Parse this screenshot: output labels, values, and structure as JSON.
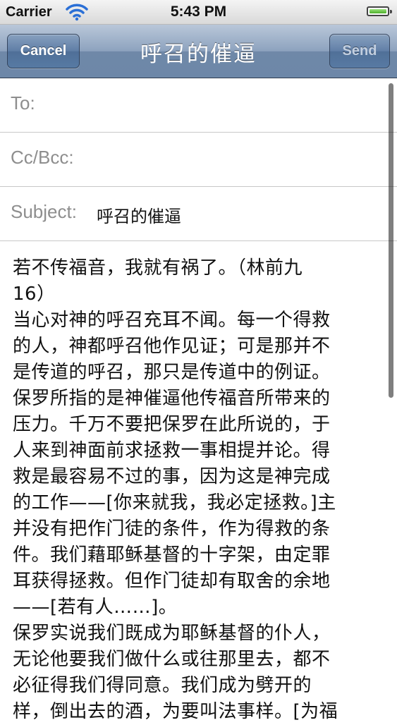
{
  "status_bar": {
    "carrier": "Carrier",
    "time": "5:43 PM",
    "icons": [
      "wifi-icon",
      "battery-icon"
    ]
  },
  "nav": {
    "title": "呼召的催逼",
    "cancel_label": "Cancel",
    "send_label": "Send"
  },
  "fields": {
    "to_label": "To:",
    "cc_label": "Cc/Bcc:",
    "subject_label": "Subject:",
    "subject_value": "呼召的催逼"
  },
  "body_lines": [
    "若不传福音，我就有祸了。（林前九",
    "16）",
    "当心对神的呼召充耳不闻。每一个得救",
    "的人，神都呼召他作见证；可是那并不",
    "是传道的呼召，那只是传道中的例证。",
    "保罗所指的是神催逼他传福音所带来的",
    "压力。千万不要把保罗在此所说的，于",
    "人来到神面前求拯救一事相提并论。得",
    "救是最容易不过的事，因为这是神完成",
    "的工作——[你来就我，我必定拯救。]主",
    "并没有把作门徒的条件，作为得救的条",
    "件。我们藉耶稣基督的十字架，由定罪",
    "耳获得拯救。但作门徒却有取舍的余地",
    "——[若有人……]。",
    "保罗实说我们既成为耶稣基督的仆人，",
    "无论他要我们做什么或往那里去，都不",
    "必征得我们得同意。我们成为劈开的",
    "样，倒出去的酒，为要叫法事样。[为福"
  ]
}
